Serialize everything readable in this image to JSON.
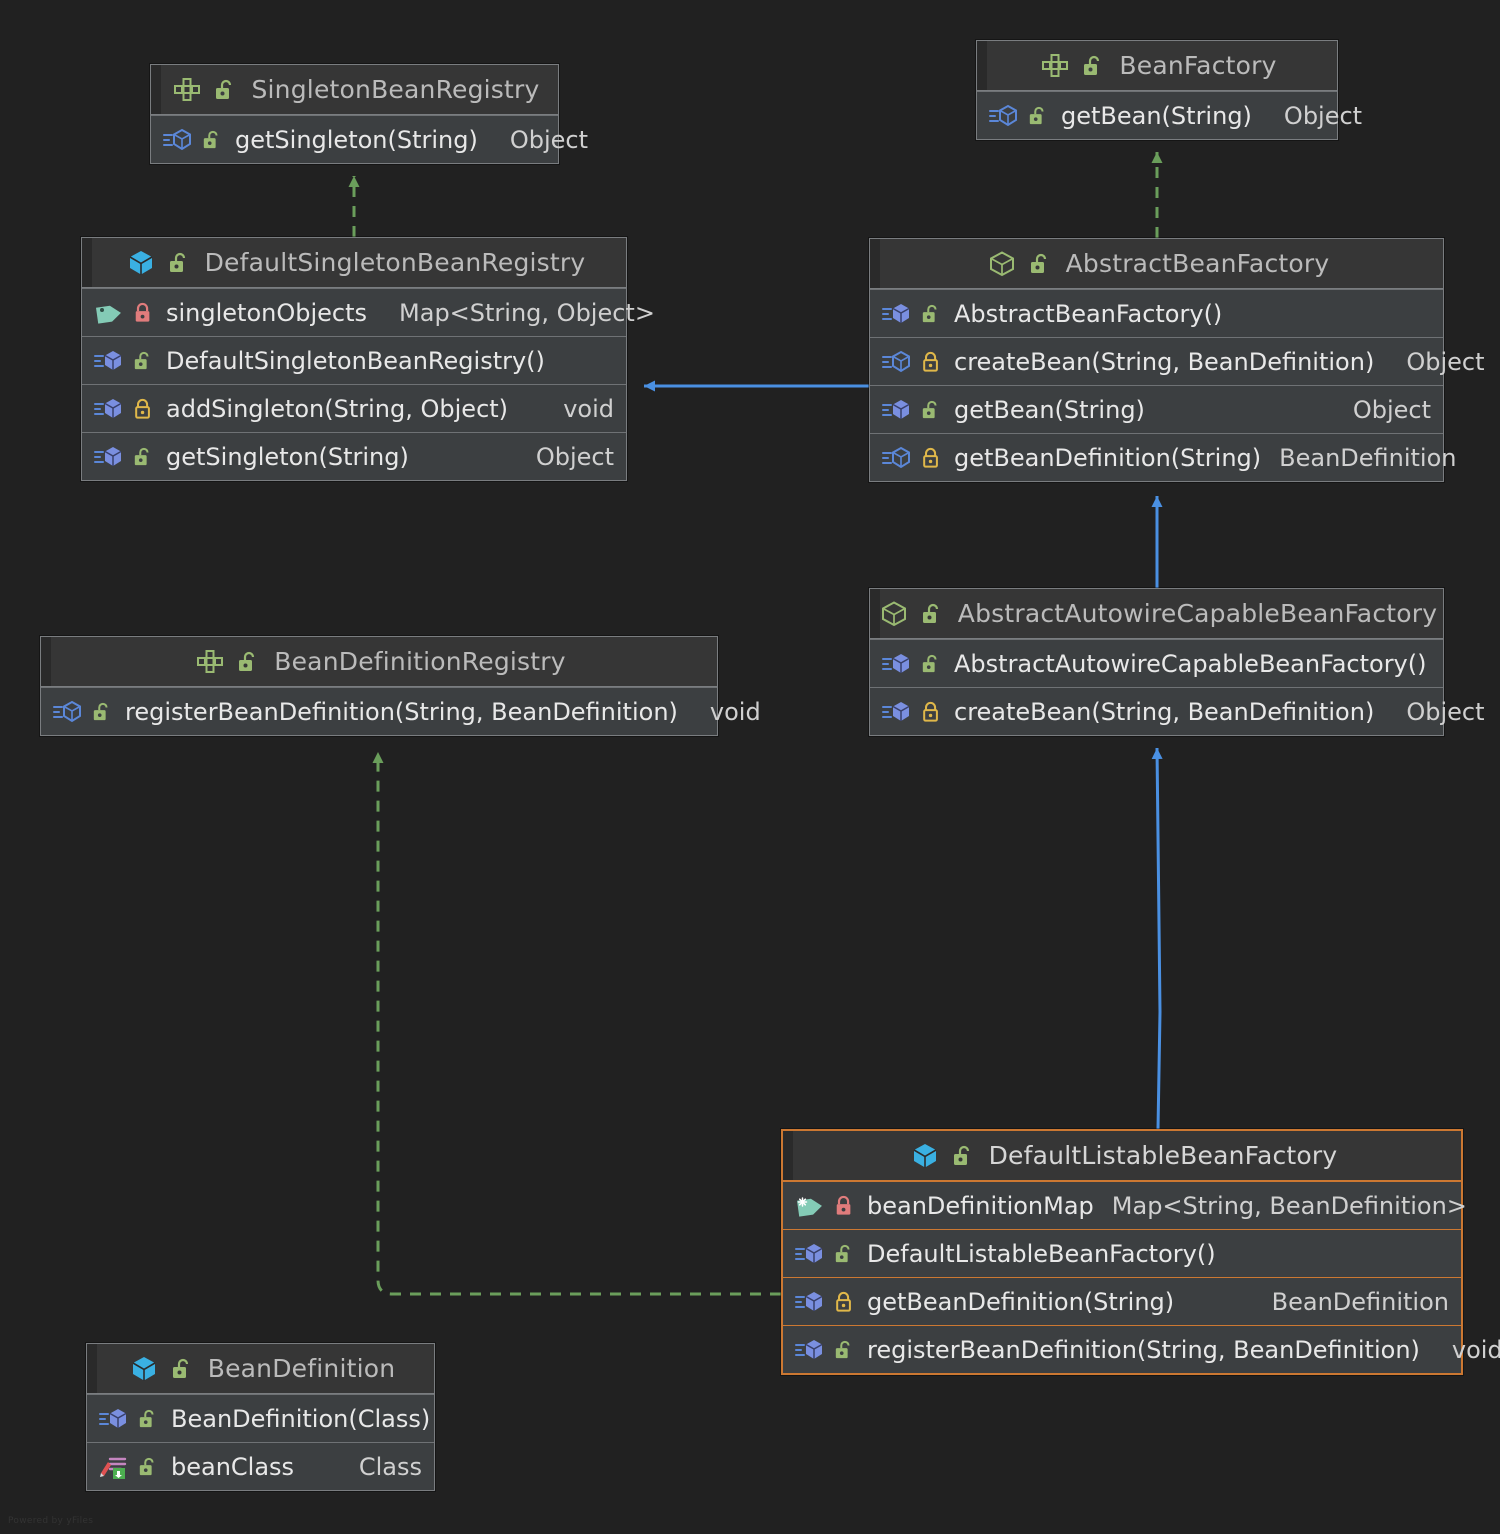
{
  "diagram": {
    "kind": "uml-class-diagram",
    "background": "#212121",
    "watermark": "Powered by yFiles",
    "colors": {
      "inheritance_arrow": "#4a90e2",
      "realization_arrow": "#6a9e5b",
      "highlight_border": "#cc7832",
      "box_border": "#7a7d80",
      "header_bg": "#363636",
      "row_bg": "#3c3f41"
    }
  },
  "classes": [
    {
      "id": "SingletonBeanRegistry",
      "name": "SingletonBeanRegistry",
      "stereotype": "interface",
      "icon": "interface-icon",
      "visibility": "public",
      "visibility_icon": "unlock-green-icon",
      "highlight": false,
      "members": [
        {
          "name": "getSingleton(String)",
          "type": "Object",
          "kind": "method-abstract",
          "icon": "method-abstract-icon",
          "visibility": "public",
          "visibility_icon": "unlock-green-icon",
          "type_inline": true
        }
      ]
    },
    {
      "id": "BeanFactory",
      "name": "BeanFactory",
      "stereotype": "interface",
      "icon": "interface-icon",
      "visibility": "public",
      "visibility_icon": "unlock-green-icon",
      "highlight": false,
      "members": [
        {
          "name": "getBean(String)",
          "type": "Object",
          "kind": "method-abstract",
          "icon": "method-abstract-icon",
          "visibility": "public",
          "visibility_icon": "unlock-green-icon",
          "type_inline": true
        }
      ]
    },
    {
      "id": "DefaultSingletonBeanRegistry",
      "name": "DefaultSingletonBeanRegistry",
      "stereotype": "class",
      "icon": "class-icon",
      "visibility": "public",
      "visibility_icon": "unlock-green-icon",
      "highlight": false,
      "members": [
        {
          "name": "singletonObjects",
          "type": "Map<String, Object>",
          "kind": "field",
          "icon": "field-icon",
          "visibility": "private",
          "visibility_icon": "lock-red-icon",
          "type_inline": true
        },
        {
          "name": "DefaultSingletonBeanRegistry()",
          "type": "",
          "kind": "method",
          "icon": "method-icon",
          "visibility": "public",
          "visibility_icon": "unlock-green-icon",
          "type_inline": false
        },
        {
          "name": "addSingleton(String, Object)",
          "type": "void",
          "kind": "method",
          "icon": "method-icon",
          "visibility": "protected",
          "visibility_icon": "lock-yellow-icon",
          "type_inline": false
        },
        {
          "name": "getSingleton(String)",
          "type": "Object",
          "kind": "method",
          "icon": "method-icon",
          "visibility": "public",
          "visibility_icon": "unlock-green-icon",
          "type_inline": false
        }
      ]
    },
    {
      "id": "AbstractBeanFactory",
      "name": "AbstractBeanFactory",
      "stereotype": "abstract-class",
      "icon": "abstract-class-icon",
      "visibility": "public",
      "visibility_icon": "unlock-green-icon",
      "highlight": false,
      "members": [
        {
          "name": "AbstractBeanFactory()",
          "type": "",
          "kind": "method",
          "icon": "method-icon",
          "visibility": "public",
          "visibility_icon": "unlock-green-icon",
          "type_inline": false
        },
        {
          "name": "createBean(String, BeanDefinition)",
          "type": "Object",
          "kind": "method-abstract",
          "icon": "method-abstract-icon",
          "visibility": "protected",
          "visibility_icon": "lock-yellow-icon",
          "type_inline": true
        },
        {
          "name": "getBean(String)",
          "type": "Object",
          "kind": "method",
          "icon": "method-icon",
          "visibility": "public",
          "visibility_icon": "unlock-green-icon",
          "type_inline": false
        },
        {
          "name": "getBeanDefinition(String)",
          "type": "BeanDefinition",
          "kind": "method-abstract",
          "icon": "method-abstract-icon",
          "visibility": "protected",
          "visibility_icon": "lock-yellow-icon",
          "type_inline": false
        }
      ]
    },
    {
      "id": "BeanDefinitionRegistry",
      "name": "BeanDefinitionRegistry",
      "stereotype": "interface",
      "icon": "interface-icon",
      "visibility": "public",
      "visibility_icon": "unlock-green-icon",
      "highlight": false,
      "members": [
        {
          "name": "registerBeanDefinition(String, BeanDefinition)",
          "type": "void",
          "kind": "method-abstract",
          "icon": "method-abstract-icon",
          "visibility": "public",
          "visibility_icon": "unlock-green-icon",
          "type_inline": true
        }
      ]
    },
    {
      "id": "AbstractAutowireCapableBeanFactory",
      "name": "AbstractAutowireCapableBeanFactory",
      "stereotype": "abstract-class",
      "icon": "abstract-class-icon",
      "visibility": "public",
      "visibility_icon": "unlock-green-icon",
      "highlight": false,
      "members": [
        {
          "name": "AbstractAutowireCapableBeanFactory()",
          "type": "",
          "kind": "method",
          "icon": "method-icon",
          "visibility": "public",
          "visibility_icon": "unlock-green-icon",
          "type_inline": false
        },
        {
          "name": "createBean(String, BeanDefinition)",
          "type": "Object",
          "kind": "method",
          "icon": "method-icon",
          "visibility": "protected",
          "visibility_icon": "lock-yellow-icon",
          "type_inline": true
        }
      ]
    },
    {
      "id": "DefaultListableBeanFactory",
      "name": "DefaultListableBeanFactory",
      "stereotype": "class",
      "icon": "class-icon",
      "visibility": "public",
      "visibility_icon": "unlock-green-icon",
      "highlight": true,
      "members": [
        {
          "name": "beanDefinitionMap",
          "type": "Map<String, BeanDefinition>",
          "kind": "field-static",
          "icon": "field-static-icon",
          "visibility": "private",
          "visibility_icon": "lock-red-icon",
          "type_inline": true
        },
        {
          "name": "DefaultListableBeanFactory()",
          "type": "",
          "kind": "method",
          "icon": "method-icon",
          "visibility": "public",
          "visibility_icon": "unlock-green-icon",
          "type_inline": false
        },
        {
          "name": "getBeanDefinition(String)",
          "type": "BeanDefinition",
          "kind": "method",
          "icon": "method-icon",
          "visibility": "protected",
          "visibility_icon": "lock-yellow-icon",
          "type_inline": false
        },
        {
          "name": "registerBeanDefinition(String, BeanDefinition)",
          "type": "void",
          "kind": "method",
          "icon": "method-icon",
          "visibility": "public",
          "visibility_icon": "unlock-green-icon",
          "type_inline": true
        }
      ]
    },
    {
      "id": "BeanDefinition",
      "name": "BeanDefinition",
      "stereotype": "class",
      "icon": "class-icon",
      "visibility": "public",
      "visibility_icon": "unlock-green-icon",
      "highlight": false,
      "members": [
        {
          "name": "BeanDefinition(Class)",
          "type": "",
          "kind": "method",
          "icon": "method-icon",
          "visibility": "public",
          "visibility_icon": "unlock-green-icon",
          "type_inline": false
        },
        {
          "name": "beanClass",
          "type": "Class",
          "kind": "property",
          "icon": "property-icon",
          "visibility": "public",
          "visibility_icon": "unlock-green-icon",
          "type_inline": false
        }
      ]
    }
  ],
  "relations": [
    {
      "from": "DefaultSingletonBeanRegistry",
      "to": "SingletonBeanRegistry",
      "type": "realization",
      "style": "dashed-green"
    },
    {
      "from": "AbstractBeanFactory",
      "to": "BeanFactory",
      "type": "realization",
      "style": "dashed-green"
    },
    {
      "from": "AbstractBeanFactory",
      "to": "DefaultSingletonBeanRegistry",
      "type": "inheritance",
      "style": "solid-blue"
    },
    {
      "from": "AbstractAutowireCapableBeanFactory",
      "to": "AbstractBeanFactory",
      "type": "inheritance",
      "style": "solid-blue"
    },
    {
      "from": "DefaultListableBeanFactory",
      "to": "AbstractAutowireCapableBeanFactory",
      "type": "inheritance",
      "style": "solid-blue"
    },
    {
      "from": "DefaultListableBeanFactory",
      "to": "BeanDefinitionRegistry",
      "type": "realization",
      "style": "dashed-green"
    }
  ]
}
